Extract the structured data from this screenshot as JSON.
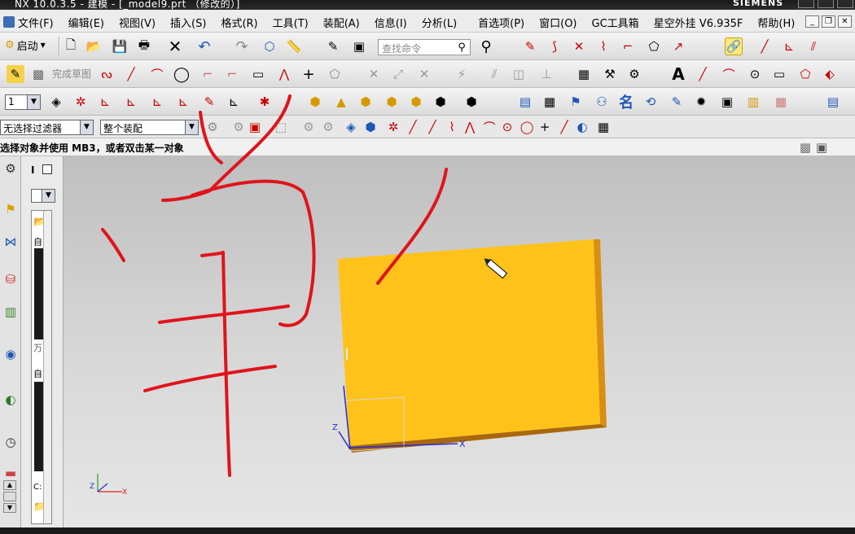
{
  "window": {
    "title": "NX 10.0.3.5 - 建模 - [_model9.prt （修改的）]",
    "brand": "SIEMENS"
  },
  "menu": {
    "items": [
      "文件(F)",
      "编辑(E)",
      "视图(V)",
      "插入(S)",
      "格式(R)",
      "工具(T)",
      "装配(A)",
      "信息(I)",
      "分析(L)",
      "首选项(P)",
      "窗口(O)",
      "GC工具箱",
      "星空外挂 V6.935F",
      "帮助(H)"
    ]
  },
  "toolbar": {
    "start_label": "启动",
    "search_placeholder": "查找命令",
    "finish_sketch_label": "完成草图",
    "text_tool_label": "A",
    "name_tool_label": "名",
    "layer_value": "1"
  },
  "selection": {
    "filter_value": "无选择过滤器",
    "scope_value": "整个装配"
  },
  "status": {
    "message": "选择对象并使用 MB3，或者双击某一对象"
  },
  "navigator": {
    "header_letter": "I",
    "row_labels": [
      "自",
      "万",
      "自",
      "C:"
    ]
  },
  "view": {
    "axis_x": "X",
    "axis_z": "Z",
    "triad_x": "X",
    "triad_z": "Z"
  },
  "colors": {
    "part_face": "#FFC21A",
    "part_edge": "#B8740C",
    "annotation": "#E0141B",
    "menu_bg": "#ECECEC"
  }
}
